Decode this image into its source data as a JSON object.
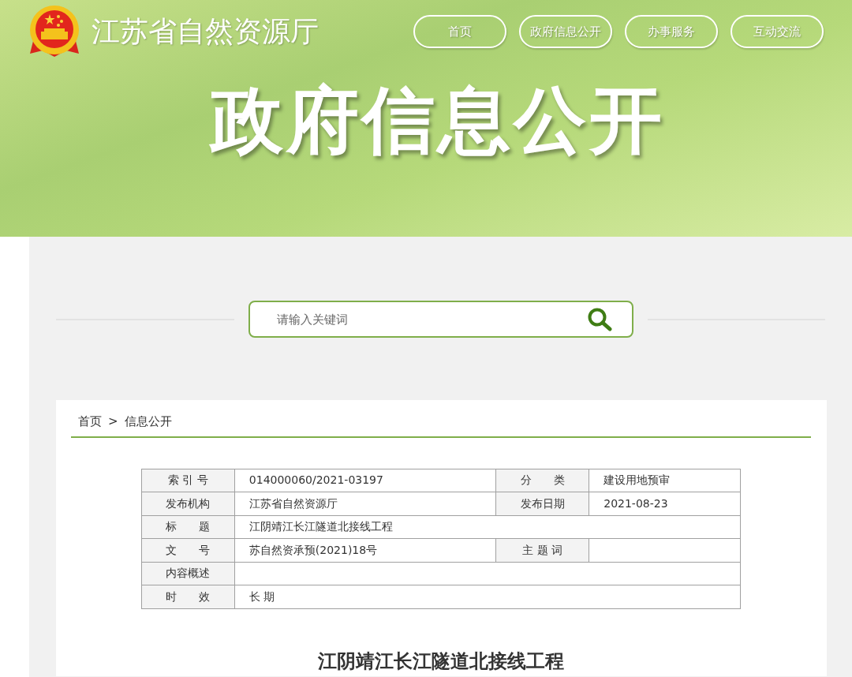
{
  "site": {
    "title": "江苏省自然资源厅"
  },
  "nav": [
    {
      "label": "首页"
    },
    {
      "label": "政府信息公开"
    },
    {
      "label": "办事服务"
    },
    {
      "label": "互动交流"
    }
  ],
  "banner": {
    "title": "政府信息公开"
  },
  "search": {
    "placeholder": "请输入关键词"
  },
  "breadcrumb": {
    "items": [
      "首页",
      "信息公开"
    ],
    "separator": ">"
  },
  "info_table": {
    "rows": [
      [
        {
          "label": "索 引 号",
          "value": "014000060/2021-03197"
        },
        {
          "label": "分　　类",
          "value": "建设用地预审"
        }
      ],
      [
        {
          "label": "发布机构",
          "value": "江苏省自然资源厅"
        },
        {
          "label": "发布日期",
          "value": "2021-08-23"
        }
      ],
      [
        {
          "label": "标　　题",
          "value": "江阴靖江长江隧道北接线工程"
        }
      ],
      [
        {
          "label": "文　　号",
          "value": "苏自然资承预(2021)18号"
        },
        {
          "label": "主 题 词"
        }
      ],
      [
        {
          "label": "内容概述"
        }
      ],
      [
        {
          "label": "时　　效",
          "value": "长 期"
        }
      ]
    ]
  },
  "article": {
    "title": "江阴靖江长江隧道北接线工程"
  }
}
